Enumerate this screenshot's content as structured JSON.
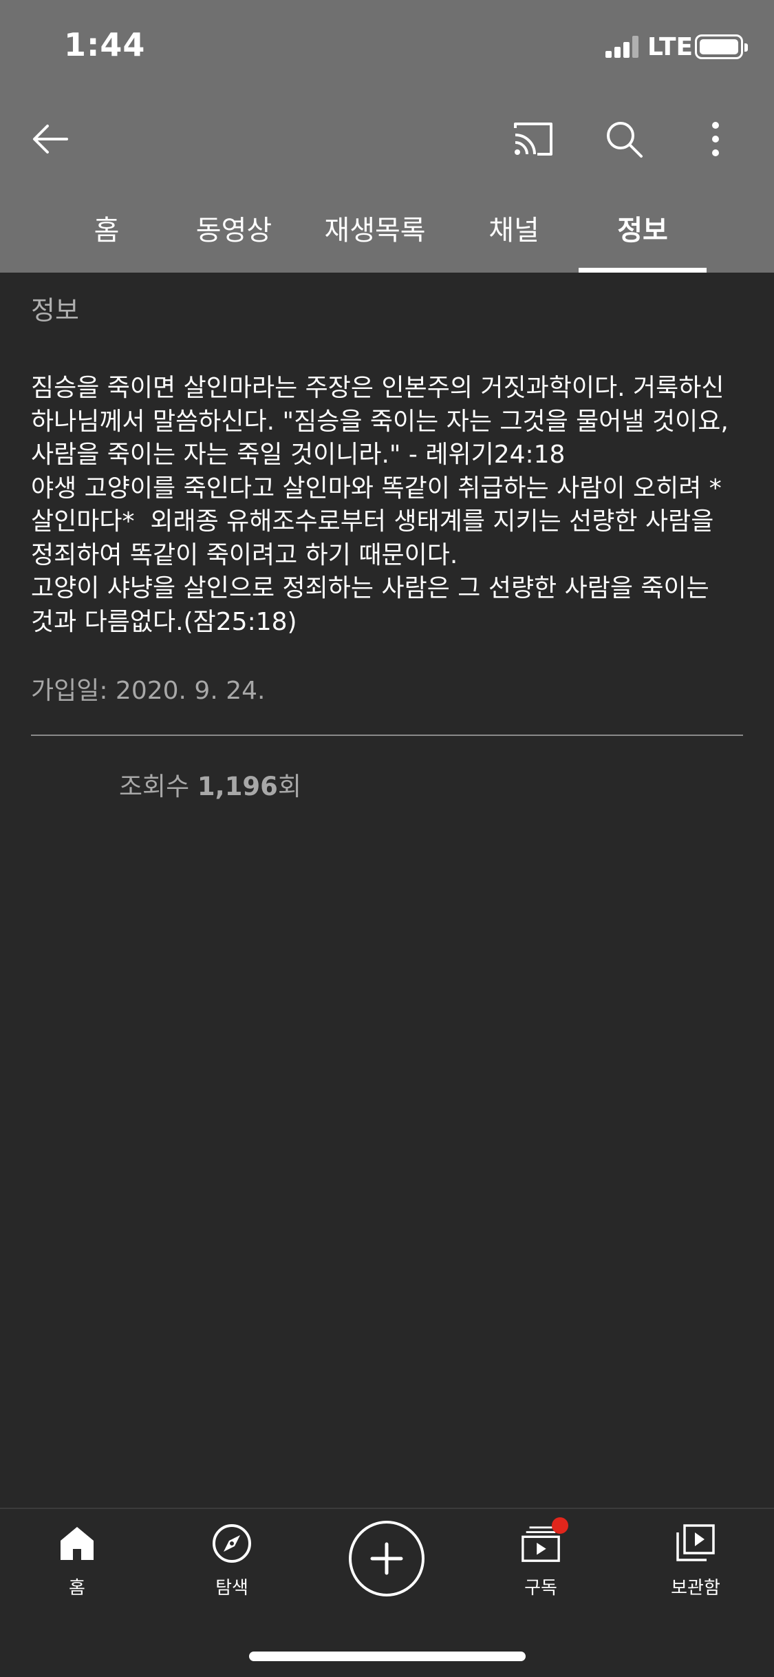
{
  "status_bar": {
    "time": "1:44",
    "carrier": "LTE"
  },
  "app_bar": {
    "icons": [
      "back-arrow-icon",
      "cast-icon",
      "search-icon",
      "more-vert-icon"
    ]
  },
  "tabs": [
    {
      "label": "홈",
      "active": false
    },
    {
      "label": "동영상",
      "active": false
    },
    {
      "label": "재생목록",
      "active": false
    },
    {
      "label": "채널",
      "active": false
    },
    {
      "label": "정보",
      "active": true
    }
  ],
  "about": {
    "section_title": "정보",
    "description": "짐승을 죽이면 살인마라는 주장은 인본주의 거짓과학이다. 거룩하신 하나님께서 말씀하신다. \"짐승을 죽이는 자는 그것을 물어낼 것이요, 사람을 죽이는 자는 죽일 것이니라.\" - 레위기24:18\n야생 고양이를 죽인다고 살인마와 똑같이 취급하는 사람이 오히려 *살인마다*  외래종 유해조수로부터 생태계를 지키는 선량한 사람을 정죄하여 똑같이 죽이려고 하기 때문이다.\n고양이 샤냥을 살인으로 정죄하는 사람은 그 선량한 사람을 죽이는 것과 다름없다.(잠25:18)",
    "joined": "가입일: 2020. 9. 24.",
    "views_prefix": "조회수 ",
    "views_count": "1,196",
    "views_suffix": "회"
  },
  "bottom_nav": {
    "items": [
      {
        "label": "홈",
        "icon": "home-icon"
      },
      {
        "label": "탐색",
        "icon": "compass-icon"
      },
      {
        "label": "",
        "icon": "plus-icon"
      },
      {
        "label": "구독",
        "icon": "subscriptions-icon"
      },
      {
        "label": "보관함",
        "icon": "library-icon"
      }
    ],
    "notification_dot_color": "#e1261c"
  },
  "colors": {
    "header_bg": "#707070",
    "page_bg": "#282828",
    "secondary_text": "#a8a8a8"
  }
}
